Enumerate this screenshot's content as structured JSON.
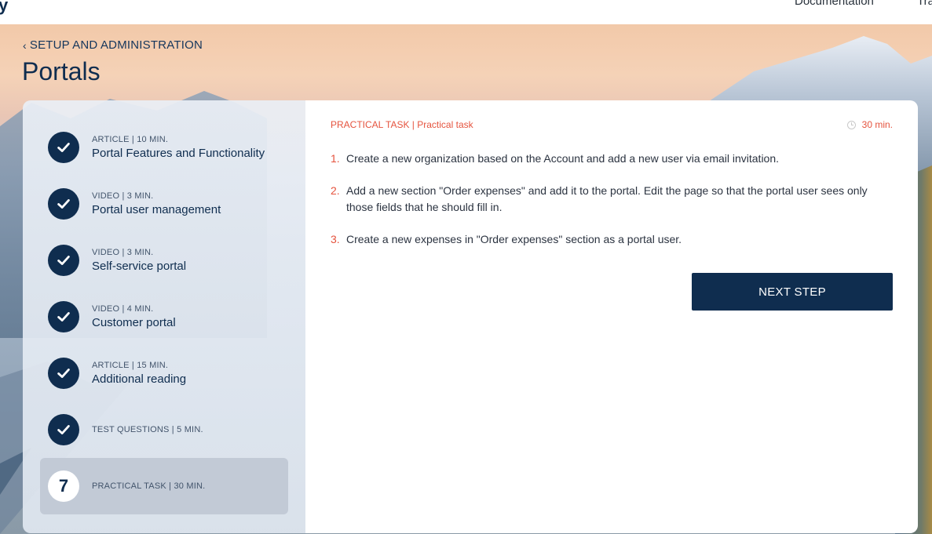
{
  "topbar": {
    "logo_fragment": "y",
    "nav_documentation": "Documentation",
    "nav_cut": "Tra"
  },
  "breadcrumb": {
    "label": "SETUP AND ADMINISTRATION"
  },
  "page_title": "Portals",
  "steps": [
    {
      "meta": "ARTICLE | 10 MIN.",
      "name": "Portal Features and Functionality",
      "state": "done"
    },
    {
      "meta": "VIDEO | 3 MIN.",
      "name": "Portal user management",
      "state": "done"
    },
    {
      "meta": "VIDEO | 3 MIN.",
      "name": "Self-service portal",
      "state": "done"
    },
    {
      "meta": "VIDEO | 4 MIN.",
      "name": "Customer portal",
      "state": "done"
    },
    {
      "meta": "ARTICLE | 15 MIN.",
      "name": "Additional reading",
      "state": "done"
    },
    {
      "meta": "TEST QUESTIONS | 5 MIN.",
      "name": "",
      "state": "done"
    },
    {
      "meta": "PRACTICAL TASK | 30 MIN.",
      "name": "",
      "state": "active",
      "number": "7"
    }
  ],
  "task": {
    "header": "PRACTICAL TASK | Practical task",
    "duration": "30 min.",
    "items": [
      {
        "num": "1.",
        "text": "Create a new organization based on the Account and add a new user via email invitation."
      },
      {
        "num": "2.",
        "text": "Add a new section \"Order expenses\" and add it to the portal. Edit the page so that the portal user sees only those fields that he should fill in."
      },
      {
        "num": "3.",
        "text": "Create a new expenses in \"Order expenses\" section as a portal user."
      }
    ],
    "next_button": "NEXT STEP"
  },
  "colors": {
    "navy": "#0f2d4f",
    "accent": "#e5533e",
    "active_step_bg": "#c2cad6"
  }
}
